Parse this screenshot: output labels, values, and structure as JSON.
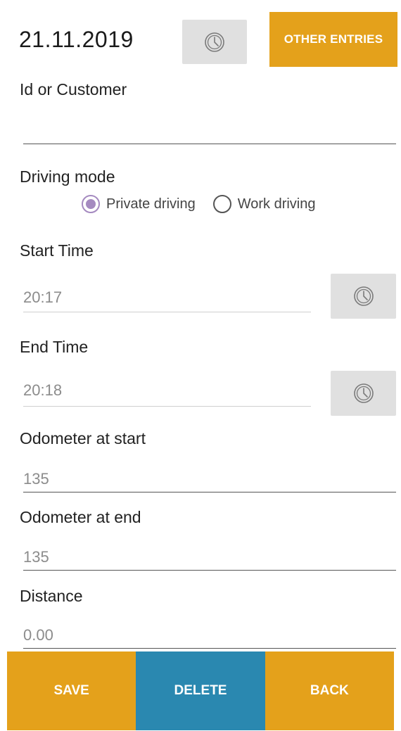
{
  "header": {
    "date": "21.11.2019",
    "other_entries_label": "OTHER ENTRIES"
  },
  "form": {
    "customer_label": "Id or Customer",
    "customer_value": "",
    "driving_mode_label": "Driving mode",
    "driving_modes": [
      {
        "label": "Private driving",
        "checked": true
      },
      {
        "label": "Work driving",
        "checked": false
      }
    ],
    "start_time_label": "Start Time",
    "start_time_value": "20:17",
    "end_time_label": "End Time",
    "end_time_value": "20:18",
    "odometer_start_label": "Odometer at start",
    "odometer_start_value": "135",
    "odometer_end_label": "Odometer at end",
    "odometer_end_value": "135",
    "distance_label": "Distance",
    "distance_value": "0.00"
  },
  "actions": {
    "save_label": "SAVE",
    "delete_label": "DELETE",
    "back_label": "BACK"
  },
  "colors": {
    "accent": "#e4a11b",
    "delete": "#2a88b0",
    "radio": "#a58ac0",
    "button_grey": "#e0e0e0"
  },
  "icons": {
    "time_picker": "clock-icon"
  }
}
